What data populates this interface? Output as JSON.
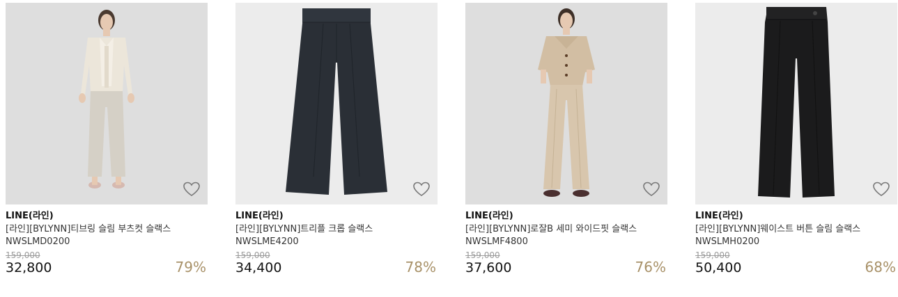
{
  "products": [
    {
      "brand": "LINE(라인)",
      "name": "[라인][BYLYNN]티브링 슬림 부츠컷 슬랙스",
      "code": "NWSLMD0200",
      "original_price": "159,000",
      "sale_price": "32,800",
      "discount": "79%",
      "image_icon": "model-photo-icon",
      "accent": "#a89168"
    },
    {
      "brand": "LINE(라인)",
      "name": "[라인][BYLYNN]트리플 크롭 슬랙스",
      "code": "NWSLME4200",
      "original_price": "159,000",
      "sale_price": "34,400",
      "discount": "78%",
      "image_icon": "pants-photo-icon",
      "accent": "#a89168"
    },
    {
      "brand": "LINE(라인)",
      "name": "[라인][BYLYNN]로잘B 세미 와이드핏 슬랙스",
      "code": "NWSLMF4800",
      "original_price": "159,000",
      "sale_price": "37,600",
      "discount": "76%",
      "image_icon": "model-photo-icon",
      "accent": "#a89168"
    },
    {
      "brand": "LINE(라인)",
      "name": "[라인][BYLYNN]웨이스트 버튼 슬림 슬랙스",
      "code": "NWSLMH0200",
      "original_price": "159,000",
      "sale_price": "50,400",
      "discount": "68%",
      "image_icon": "pants-photo-icon",
      "accent": "#a89168"
    }
  ]
}
